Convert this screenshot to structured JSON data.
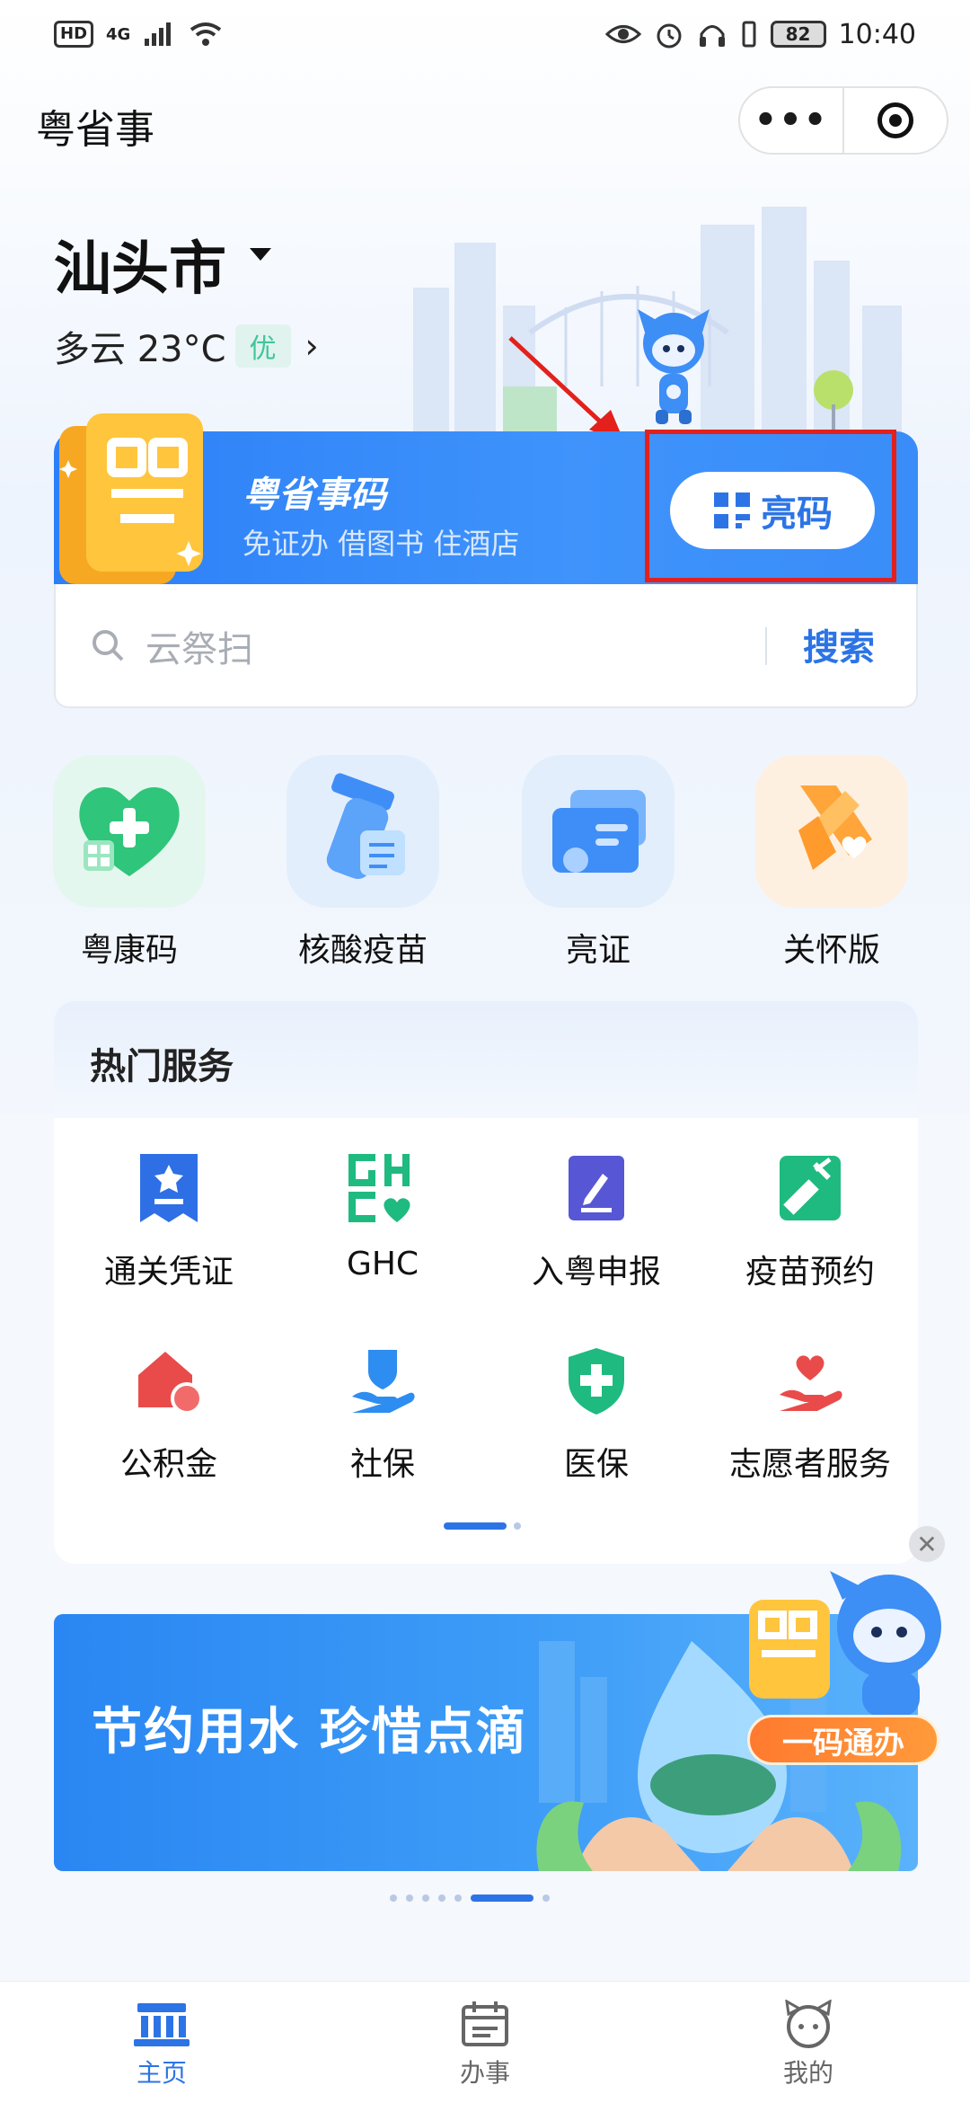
{
  "status_bar": {
    "network": "4G",
    "hd": "HD",
    "battery": "82",
    "time": "10:40"
  },
  "header": {
    "app_title": "粤省事",
    "more_icon": "more-dots-icon",
    "close_icon": "target-icon"
  },
  "location": {
    "city": "汕头市",
    "weather": "多云 23°C",
    "aqi": "优"
  },
  "code_card": {
    "title": "粤省事码",
    "subtitle": "免证办 借图书 住酒店",
    "button_label": "亮码",
    "button_icon": "qr-code-icon"
  },
  "search": {
    "placeholder": "云祭扫",
    "button_label": "搜索"
  },
  "quick_entries": [
    {
      "label": "粤康码",
      "icon": "green-heart-health-icon"
    },
    {
      "label": "核酸疫苗",
      "icon": "test-tube-icon"
    },
    {
      "label": "亮证",
      "icon": "id-card-icon"
    },
    {
      "label": "关怀版",
      "icon": "care-ribbon-icon"
    }
  ],
  "hot_services": {
    "title": "热门服务",
    "items": [
      {
        "label": "通关凭证",
        "icon": "ribbon-badge-icon"
      },
      {
        "label": "GHC",
        "icon": "ghc-logo-icon"
      },
      {
        "label": "入粤申报",
        "icon": "edit-form-icon"
      },
      {
        "label": "疫苗预约",
        "icon": "syringe-icon"
      },
      {
        "label": "公积金",
        "icon": "house-fund-icon"
      },
      {
        "label": "社保",
        "icon": "social-security-icon"
      },
      {
        "label": "医保",
        "icon": "medical-shield-icon"
      },
      {
        "label": "志愿者服务",
        "icon": "heart-hand-icon"
      }
    ]
  },
  "banner": {
    "text": "节约用水 珍惜点滴",
    "promo_tag": "一码通办"
  },
  "bottom_nav": [
    {
      "label": "主页",
      "icon": "home-icon",
      "active": true
    },
    {
      "label": "办事",
      "icon": "calendar-icon",
      "active": false
    },
    {
      "label": "我的",
      "icon": "profile-mascot-icon",
      "active": false
    }
  ],
  "colors": {
    "accent": "#2c74e6",
    "highlight": "#e3201b",
    "card_blue": "#3a8df8"
  }
}
